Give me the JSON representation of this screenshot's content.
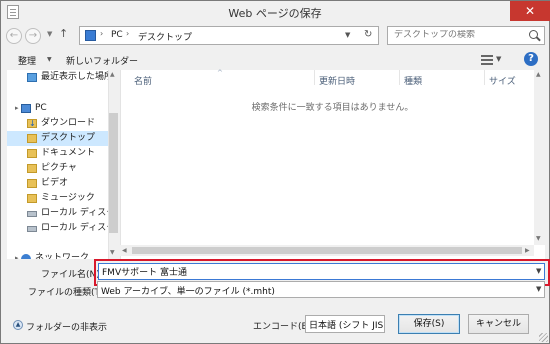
{
  "window": {
    "title": "Web ページの保存",
    "close_label": "✕"
  },
  "nav": {
    "back_glyph": "←",
    "forward_glyph": "→",
    "up_glyph": "↑",
    "address": {
      "segments": [
        "PC",
        "デスクトップ"
      ],
      "separator": "›",
      "refresh_glyph": "↻"
    },
    "search": {
      "placeholder": "デスクトップの検索"
    }
  },
  "commandbar": {
    "organize": "整理",
    "new_folder": "新しいフォルダー",
    "help": "?"
  },
  "sidebar": {
    "items": [
      {
        "label": "最近表示した場所",
        "icon": "recent-places-icon"
      },
      {
        "label": "PC",
        "icon": "pc-icon"
      },
      {
        "label": "ダウンロード",
        "icon": "downloads-folder-icon"
      },
      {
        "label": "デスクトップ",
        "icon": "desktop-folder-icon",
        "selected": true
      },
      {
        "label": "ドキュメント",
        "icon": "documents-folder-icon"
      },
      {
        "label": "ピクチャ",
        "icon": "pictures-folder-icon"
      },
      {
        "label": "ビデオ",
        "icon": "videos-folder-icon"
      },
      {
        "label": "ミュージック",
        "icon": "music-folder-icon"
      },
      {
        "label": "ローカル ディスク (C",
        "icon": "disk-c-icon"
      },
      {
        "label": "ローカル ディスク (D",
        "icon": "disk-d-icon"
      },
      {
        "label": "ネットワーク",
        "icon": "network-icon"
      }
    ],
    "expand_glyph": "▸"
  },
  "filelist": {
    "columns": [
      "名前",
      "更新日時",
      "種類",
      "サイズ"
    ],
    "empty_message": "検索条件に一致する項目はありません。"
  },
  "form": {
    "filename_label": "ファイル名(N):",
    "filename_value": "FMVサポート 富士通",
    "filetype_label": "ファイルの種類(T):",
    "filetype_value": "Web アーカイブ、単一のファイル (*.mht)"
  },
  "footer": {
    "hide_folders": "フォルダーの非表示",
    "encoding_label": "エンコード(E):",
    "encoding_value": "日本語 (シフト JIS)",
    "save_button": "保存(S)",
    "cancel_button": "キャンセル"
  },
  "colors": {
    "highlight_outline": "#d8182b",
    "selection": "#cde8ff",
    "close_button": "#c7372f"
  }
}
